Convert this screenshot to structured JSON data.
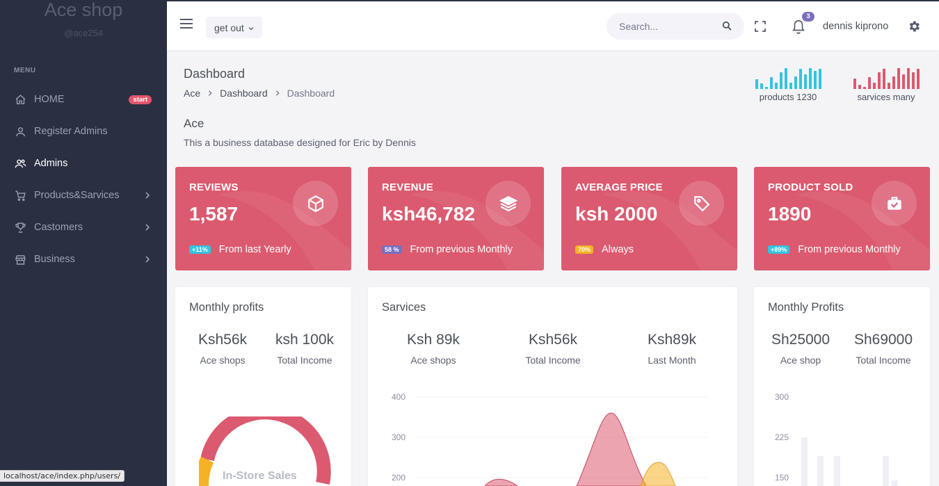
{
  "sidebar": {
    "brand": "Ace shop",
    "brand_sub": "@ace254",
    "menu_title": "MENU",
    "items": [
      {
        "label": "HOME",
        "icon": "home-icon",
        "badge": "start"
      },
      {
        "label": "Register Admins",
        "icon": "user-icon"
      },
      {
        "label": "Admins",
        "icon": "users-icon",
        "active": true
      },
      {
        "label": "Products&Sarvices",
        "icon": "cart-icon",
        "has_submenu": true
      },
      {
        "label": "Castomers",
        "icon": "trophy-icon",
        "has_submenu": true
      },
      {
        "label": "Business",
        "icon": "store-icon",
        "has_submenu": true
      }
    ]
  },
  "status_url": "localhost/ace/index.php/users/",
  "topbar": {
    "dropdown_label": "get out",
    "search_placeholder": "Search...",
    "notification_count": "3",
    "username": "dennis kiprono"
  },
  "page": {
    "title": "Dashboard",
    "breadcrumb": [
      "Ace",
      "Dashboard",
      "Dashboard"
    ],
    "section_title": "Ace",
    "section_desc": "This a business database designed for Eric by Dennis"
  },
  "mini_stats": [
    {
      "label": "products 1230",
      "color": "#34c3e0",
      "values": [
        0.45,
        0.25,
        0.1,
        0.55,
        0.3,
        0.8,
        1.0,
        0.3,
        0.6,
        0.95,
        0.7,
        1.0,
        0.85,
        0.95
      ]
    },
    {
      "label": "sarvices many",
      "color": "#db5a6f",
      "values": [
        0.5,
        0.2,
        0.1,
        0.55,
        0.3,
        0.8,
        0.95,
        0.3,
        0.6,
        1.0,
        0.7,
        1.0,
        0.8,
        0.95
      ]
    }
  ],
  "stat_cards": [
    {
      "title": "REVIEWS",
      "value": "1,587",
      "pill": "+11%",
      "pill_color": "#34c3e0",
      "foot": "From last Yearly",
      "icon": "cube-icon"
    },
    {
      "title": "REVENUE",
      "value": "ksh46,782",
      "pill": "58 %",
      "pill_color": "#7a6fbe",
      "foot": "From previous Monthly",
      "icon": "layers-icon"
    },
    {
      "title": "AVERAGE PRICE",
      "value": "ksh 2000",
      "pill": "70%",
      "pill_color": "#f5b225",
      "foot": "Always",
      "icon": "tag-icon"
    },
    {
      "title": "PRODUCT SOLD",
      "value": "1890",
      "pill": "+89%",
      "pill_color": "#34c3e0",
      "foot": "From previous Monthly",
      "icon": "briefcase-icon"
    }
  ],
  "cards": {
    "monthly_profits": {
      "title": "Monthly profits",
      "stats": [
        {
          "value": "Ksh56k",
          "label": "Ace shops"
        },
        {
          "value": "ksh 100k",
          "label": "Total Income"
        }
      ],
      "donut_label": "In-Store Sales"
    },
    "sarvices": {
      "title": "Sarvices",
      "stats": [
        {
          "value": "Ksh 89k",
          "label": "Ace shops"
        },
        {
          "value": "Ksh56k",
          "label": "Total Income"
        },
        {
          "value": "Ksh89k",
          "label": "Last Month"
        }
      ],
      "y_ticks": [
        "400",
        "300",
        "200"
      ]
    },
    "monthly_profits_2": {
      "title": "Monthly Profits",
      "stats": [
        {
          "value": "Sh25000",
          "label": "Ace shop"
        },
        {
          "value": "Sh69000",
          "label": "Total Income"
        }
      ],
      "y_ticks": [
        "300",
        "225",
        "150"
      ]
    }
  },
  "colors": {
    "sidebar": "#2a3042",
    "accent_red": "#db5a6f",
    "accent_purple": "#7a6fbe"
  }
}
